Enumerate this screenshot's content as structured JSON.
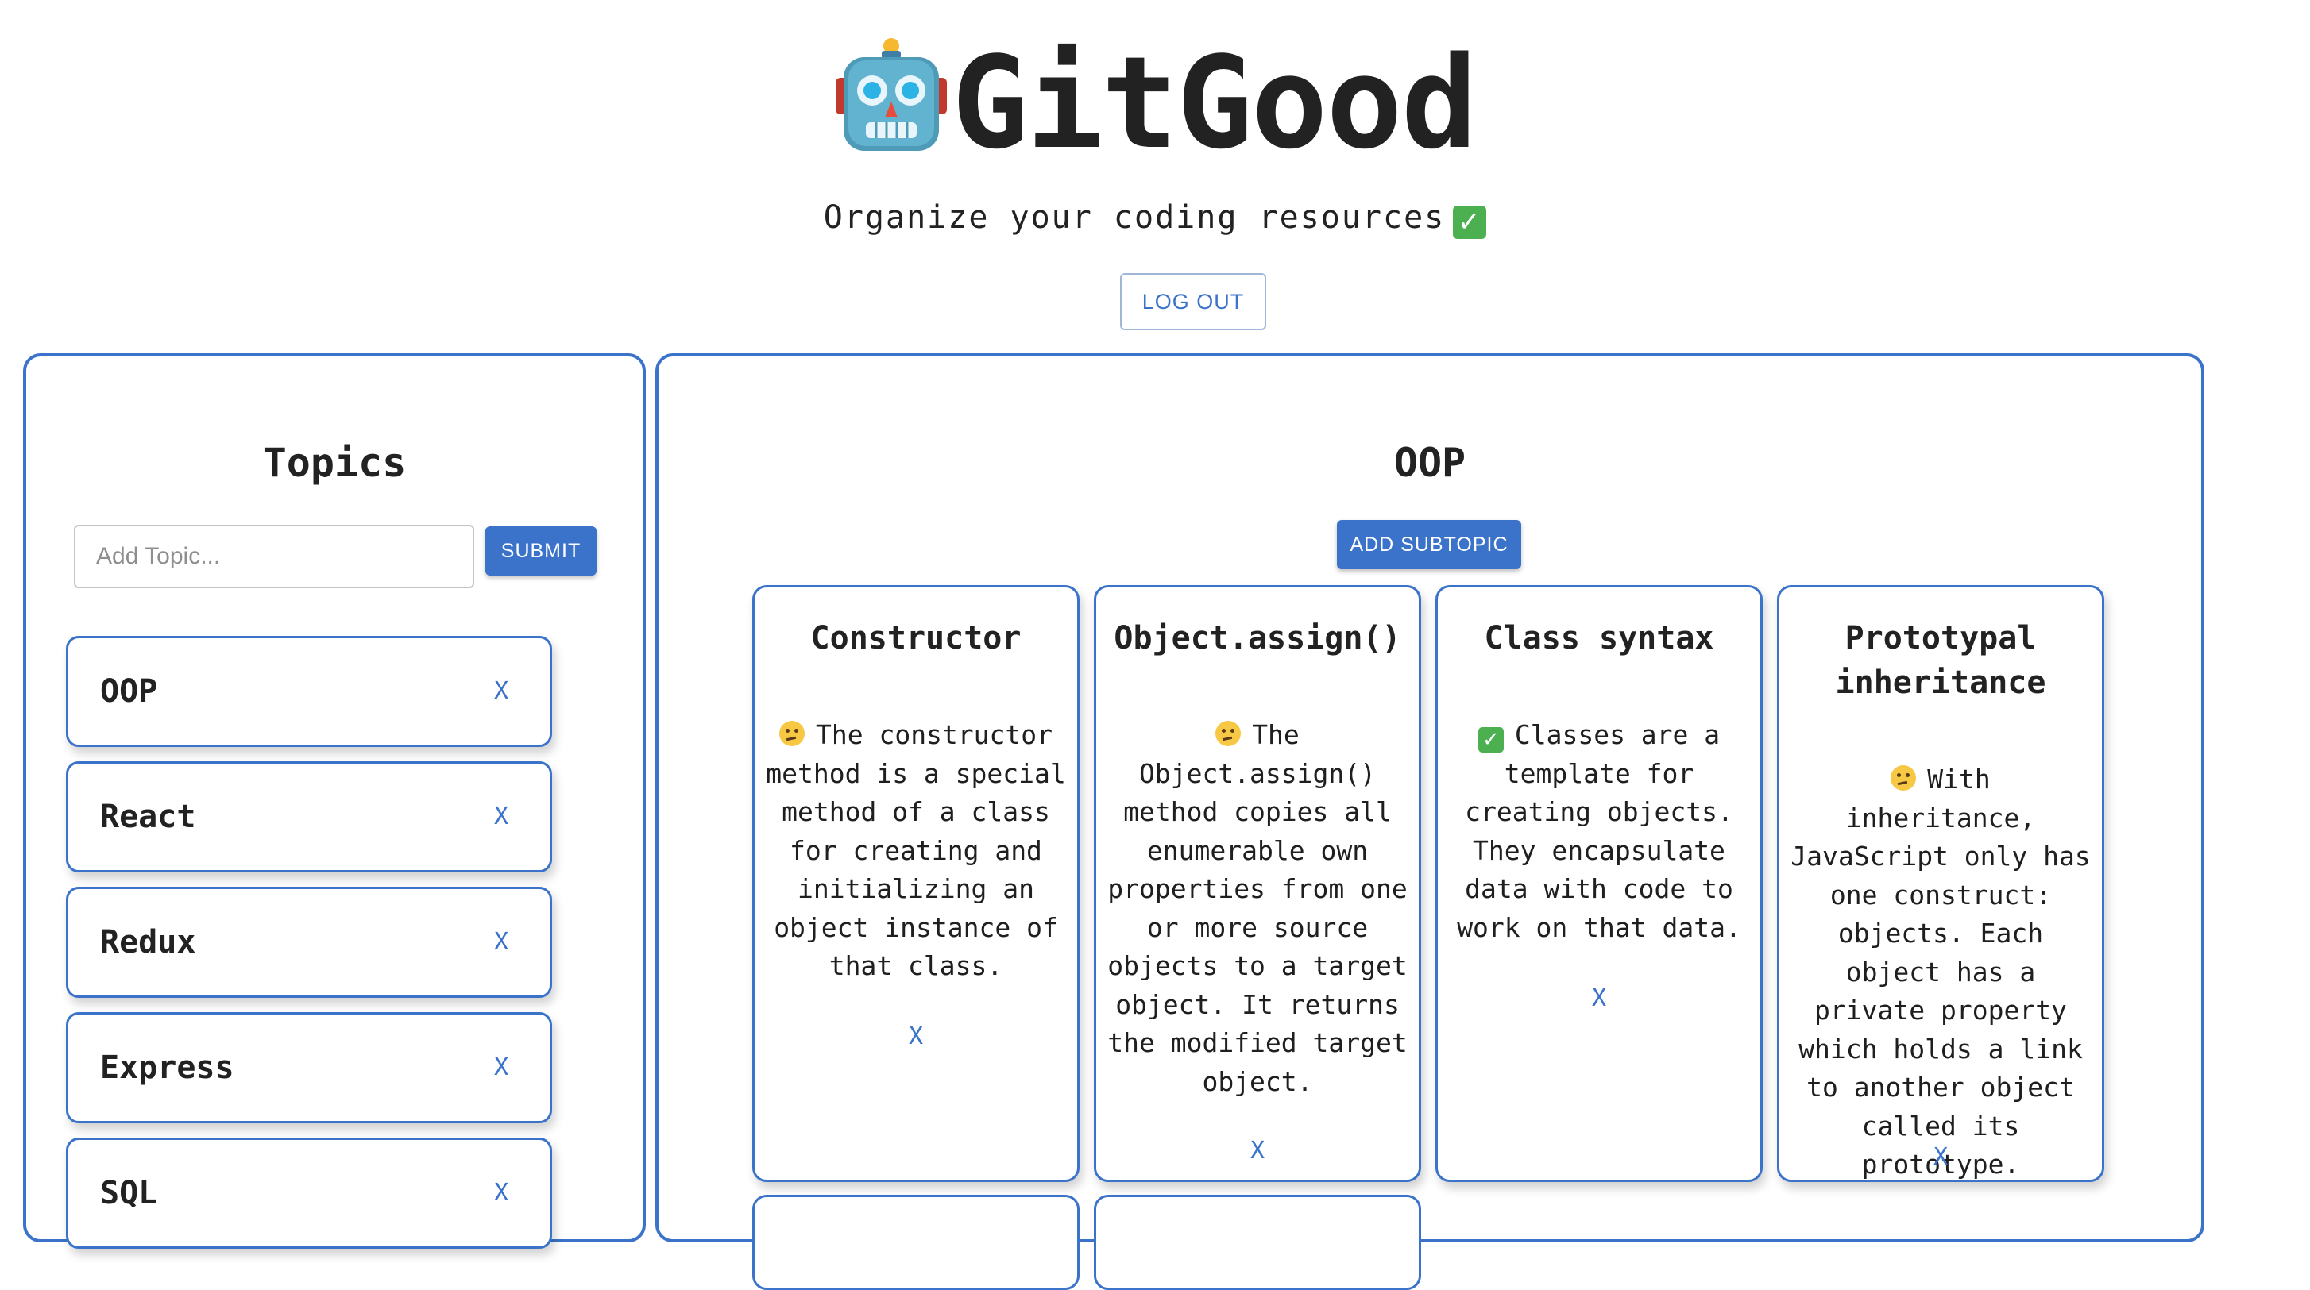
{
  "header": {
    "title": "GitGood",
    "title_icon": "robot-face-icon",
    "tagline": "Organize your coding resources",
    "tagline_icon": "check-mark-icon"
  },
  "logout_label": "LOG OUT",
  "sidebar": {
    "heading": "Topics",
    "input_placeholder": "Add Topic...",
    "submit_label": "SUBMIT",
    "remove_label": "X",
    "topics": [
      {
        "label": "OOP"
      },
      {
        "label": "React"
      },
      {
        "label": "Redux"
      },
      {
        "label": "Express"
      },
      {
        "label": "SQL"
      }
    ]
  },
  "main": {
    "heading": "OOP",
    "add_subtopic_label": "ADD SUBTOPIC",
    "remove_label": "X",
    "subtopics": [
      {
        "title": "Constructor",
        "status_icon": "thinking-face-icon",
        "description": "The constructor method is a special method of a class for creating and initializing an object instance of that class."
      },
      {
        "title": "Object.assign()",
        "status_icon": "thinking-face-icon",
        "description": "The Object.assign() method copies all enumerable own properties from one or more source objects to a target object. It returns the modified target object."
      },
      {
        "title": "Class syntax",
        "status_icon": "check-mark-icon",
        "description": "Classes are a template for creating objects. They encapsulate data with code to work on that data."
      },
      {
        "title": "Prototypal inheritance",
        "status_icon": "thinking-face-icon",
        "description": "With inheritance, JavaScript only has one construct: objects. Each object has a private property which holds a link to another object called its prototype."
      }
    ]
  },
  "colors": {
    "accent": "#3a73c9",
    "text": "#222222",
    "check_green": "#4caf50",
    "thinking_yellow": "#f7c843"
  }
}
